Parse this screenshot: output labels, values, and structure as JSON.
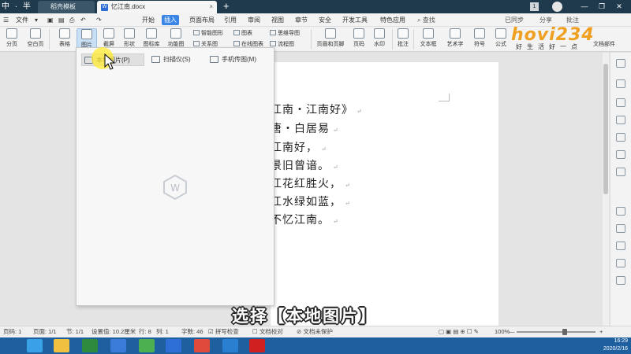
{
  "tabbar": {
    "logo": "中 · 半",
    "tab_template": "稻壳模板",
    "tab_doc": "忆江南.docx",
    "tab_doc_close": "×",
    "new_tab": "+",
    "badge": "1",
    "win_minimize": "—",
    "win_restore": "❐",
    "win_close": "✕"
  },
  "menubar": {
    "file": "文件",
    "items": [
      "开始",
      "插入",
      "页面布局",
      "引用",
      "审阅",
      "视图",
      "章节",
      "安全",
      "开发工具",
      "特色应用"
    ],
    "active_item": "插入",
    "search": "查找",
    "sync": "已同步",
    "share": "分享",
    "comment": "批注"
  },
  "ribbon": {
    "paging": "分页",
    "blank_page": "空白页",
    "table": "表格",
    "picture": "图片",
    "screenshot": "截屏",
    "shape": "形状",
    "icon_lib": "图标库",
    "function_chart": "功能图",
    "smart_art": "智能图形",
    "chart": "图表",
    "mind_map": "思维导图",
    "relation_chart": "关系图",
    "online_chart": "在线图表",
    "flow_chart": "流程图",
    "header_footer": "页眉和页脚",
    "page_number": "页码",
    "watermark": "水印",
    "comment": "批注",
    "text_box": "文本框",
    "art_text": "艺术字",
    "symbol": "符号",
    "formula": "公式",
    "more": "文档部件"
  },
  "brand_logo": {
    "text": "hovi234",
    "tagline": "好生活好一点"
  },
  "popup": {
    "local_picture": "本地图片(P)",
    "scanner": "扫描仪(S)",
    "phone_picture": "手机传图(M)"
  },
  "document": {
    "lines": [
      "江南・江南好》",
      "唐・白居易",
      "江南好，",
      "景旧曾谙。",
      "江花红胜火，",
      "江水绿如蓝，",
      "不忆江南。"
    ],
    "paragraph_mark": "↵"
  },
  "caption": "选择【本地图片】",
  "statusbar": {
    "page": "页码: 1",
    "pages": "页面: 1/1",
    "section": "节: 1/1",
    "position": "设置值: 10.2厘米",
    "row": "行: 8",
    "col": "列: 1",
    "words": "字数: 46",
    "spell": "拼写检查",
    "proof": "文档校对",
    "unprotected": "文档未保护",
    "zoom": "100%",
    "zoom_minus": "—",
    "zoom_plus": "+"
  },
  "taskbar": {
    "time": "16:29",
    "date": "2020/2/16"
  },
  "colors": {
    "tabbar": "#1f3a4d",
    "accent": "#3a86e6",
    "taskbar": "#1e5fa0",
    "brand_orange": "#f0a020"
  }
}
